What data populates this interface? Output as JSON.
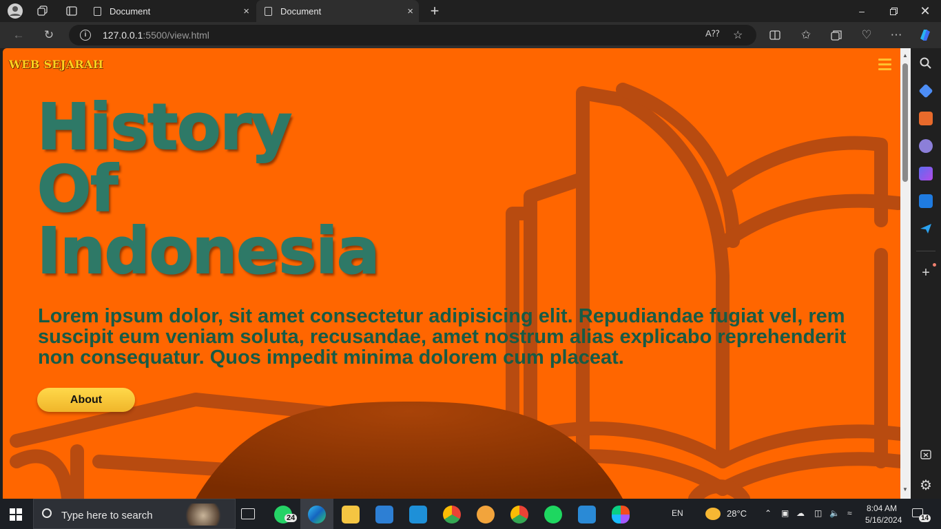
{
  "browser": {
    "tabs": [
      {
        "title": "Document",
        "close": "×"
      },
      {
        "title": "Document",
        "close": "×"
      }
    ],
    "new_tab": "+",
    "address": {
      "host": "127.0.0.1",
      "path": ":5500/view.html"
    },
    "info_glyph": "i"
  },
  "page": {
    "logo": "WEB SEJARAH",
    "title_lines": [
      "History",
      "Of",
      "Indonesia"
    ],
    "paragraph": "Lorem ipsum dolor, sit amet consectetur adipisicing elit. Repudiandae fugiat vel, rem suscipit eum veniam soluta, recusandae, amet nostrum alias explicabo reprehenderit non consequatur. Quos impedit minima dolorem cum placeat.",
    "about_button": "About",
    "colors": {
      "background": "#ff6600",
      "title": "#2e7967",
      "paragraph": "#175b45",
      "button": "#ffd84a",
      "logo": "#ffd21f"
    }
  },
  "taskbar": {
    "search_placeholder": "Type here to search",
    "whatsapp_badge": "24",
    "language": "EN",
    "weather": "28°C",
    "time": "8:04 AM",
    "date": "5/16/2024",
    "notification_count": "14"
  },
  "icons": [
    "profile-icon",
    "workspaces-icon",
    "tab-actions-icon",
    "back-icon",
    "refresh-icon",
    "read-aloud-icon",
    "favorite-icon",
    "split-screen-icon",
    "favorites-icon",
    "collections-icon",
    "performance-icon",
    "more-icon",
    "copilot-icon",
    "search-icon",
    "shopping-icon",
    "tools-icon",
    "games-icon",
    "copilot-sidebar-icon",
    "outlook-icon",
    "send-icon",
    "add-icon",
    "hide-sidebar-icon",
    "settings-icon",
    "hamburger-icon",
    "windows-icon",
    "task-view-icon"
  ]
}
